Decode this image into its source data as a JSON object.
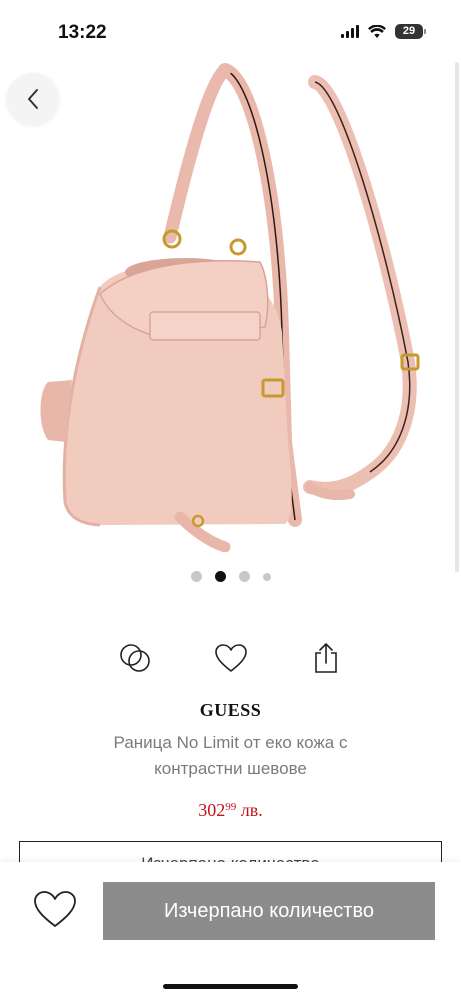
{
  "status_bar": {
    "time": "13:22",
    "battery": "29",
    "icons": [
      "signal-icon",
      "wifi-icon",
      "battery-icon"
    ]
  },
  "gallery": {
    "image_description": "pink leather backpack",
    "slide_count": 4,
    "active_slide": 2
  },
  "actions": [
    "compare-icon",
    "heart-icon",
    "share-icon"
  ],
  "product": {
    "brand": "GUESS",
    "name": "Раница No Limit от еко кожа с контрастни шевове",
    "price_main": "302",
    "price_cents": "99",
    "price_currency": " лв."
  },
  "quantity_notice": "Изчерпано количество",
  "bottom_bar": {
    "cta_label": "Изчерпано количество"
  },
  "colors": {
    "price": "#c4141b",
    "cta_background": "#8c8c8c",
    "bag": "#f0c8bd"
  }
}
